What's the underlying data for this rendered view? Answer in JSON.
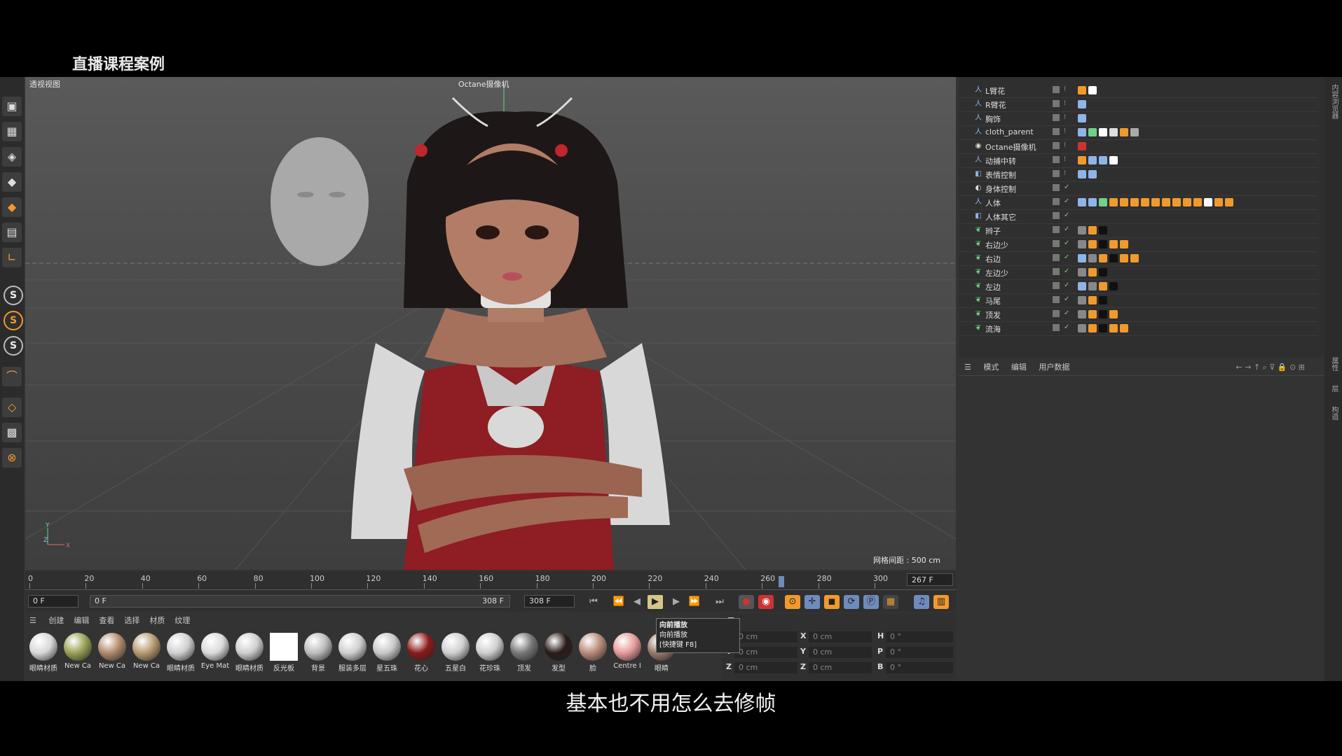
{
  "course_title": "直播课程案例",
  "subtitle": "基本也不用怎么去修帧",
  "viewport": {
    "label": "透视视图",
    "camera_label": "Octane摄像机",
    "grid_info": "网格间距 : 500 cm",
    "axis_y": "Y",
    "axis_z": "Z",
    "axis_x": "X"
  },
  "timeline": {
    "ticks": [
      "0",
      "20",
      "40",
      "60",
      "80",
      "100",
      "120",
      "140",
      "160",
      "180",
      "200",
      "220",
      "240",
      "260",
      "280",
      "300"
    ],
    "playhead_frame": 267,
    "max_frame": 308,
    "end_frame_display": "267 F",
    "start_field": "0 F",
    "range_start": "0 F",
    "range_end": "308 F",
    "end_field": "308 F"
  },
  "tooltip": {
    "title": "向前播放",
    "desc": "向前播放",
    "shortcut": "[快捷键 F8]"
  },
  "materials_menu": [
    "创建",
    "编辑",
    "查看",
    "选择",
    "材质",
    "纹理"
  ],
  "materials": [
    {
      "label": "眼睛材质",
      "color": "#d8d8d8"
    },
    {
      "label": "New Ca",
      "color": "#9aa055"
    },
    {
      "label": "New Ca",
      "color": "#b08a6a"
    },
    {
      "label": "New Ca",
      "color": "#b69a70"
    },
    {
      "label": "眼睛材质",
      "color": "#d0d0d0"
    },
    {
      "label": "Eye Mat",
      "color": "#dadada"
    },
    {
      "label": "眼睛材质",
      "color": "#cfcfcf"
    },
    {
      "label": "反光板",
      "color": "#ffffff"
    },
    {
      "label": "背景",
      "color": "#bdbdbd"
    },
    {
      "label": "服装多层",
      "color": "#cfcfcf"
    },
    {
      "label": "星五珠",
      "color": "#c9c9c9"
    },
    {
      "label": "花心",
      "color": "#8b1a1a"
    },
    {
      "label": "五星白",
      "color": "#cfcfcf"
    },
    {
      "label": "花珍珠",
      "color": "#cfcfcf"
    },
    {
      "label": "顶发",
      "color": "#777777"
    },
    {
      "label": "发型",
      "color": "#2a1c18"
    },
    {
      "label": "脸",
      "color": "#b88a78"
    },
    {
      "label": "Centre I",
      "color": "#e79a9a"
    },
    {
      "label": "眼睛",
      "color": "#9a7a6a"
    }
  ],
  "coords": {
    "rows": [
      {
        "a": "X",
        "av": "0 cm",
        "b": "X",
        "bv": "0 cm",
        "c": "H",
        "cv": "0 °"
      },
      {
        "a": "Y",
        "av": "0 cm",
        "b": "Y",
        "bv": "0 cm",
        "c": "P",
        "cv": "0 °"
      },
      {
        "a": "Z",
        "av": "0 cm",
        "b": "Z",
        "bv": "0 cm",
        "c": "B",
        "cv": "0 °"
      }
    ]
  },
  "objects": [
    {
      "name": "L臂花",
      "icon": "人",
      "icon_color": "#8fb4e8"
    },
    {
      "name": "R臂花",
      "icon": "人",
      "icon_color": "#8fb4e8"
    },
    {
      "name": "胸饰",
      "icon": "人",
      "icon_color": "#8fb4e8"
    },
    {
      "name": "cloth_parent",
      "icon": "人",
      "icon_color": "#8fb4e8"
    },
    {
      "name": "Octane摄像机",
      "icon": "◉",
      "icon_color": "#dddddd"
    },
    {
      "name": "动捕中转",
      "icon": "人",
      "icon_color": "#8fb4e8"
    },
    {
      "name": "表情控制",
      "icon": "◧",
      "icon_color": "#8fb4e8"
    },
    {
      "name": "身体控制",
      "icon": "◐",
      "icon_color": "#dddddd"
    },
    {
      "name": "人体",
      "icon": "人",
      "icon_color": "#8fb4e8"
    },
    {
      "name": "人体其它",
      "icon": "◧",
      "icon_color": "#8fb4e8"
    },
    {
      "name": "辫子",
      "icon": "❦",
      "icon_color": "#6fd18a"
    },
    {
      "name": "右边少",
      "icon": "❦",
      "icon_color": "#6fd18a"
    },
    {
      "name": "右边",
      "icon": "❦",
      "icon_color": "#6fd18a"
    },
    {
      "name": "左边少",
      "icon": "❦",
      "icon_color": "#6fd18a"
    },
    {
      "name": "左边",
      "icon": "❦",
      "icon_color": "#6fd18a"
    },
    {
      "name": "马尾",
      "icon": "❦",
      "icon_color": "#6fd18a"
    },
    {
      "name": "顶发",
      "icon": "❦",
      "icon_color": "#6fd18a"
    },
    {
      "name": "流海",
      "icon": "❦",
      "icon_color": "#6fd18a"
    }
  ],
  "attr_menu": [
    "模式",
    "编辑",
    "用户数据"
  ],
  "right_strip": [
    "内容浏览器",
    "属性",
    "层",
    "构造"
  ],
  "colors": {
    "accent": "#f09a2e",
    "panel": "#333333",
    "highlight": "#6f8bbd"
  }
}
